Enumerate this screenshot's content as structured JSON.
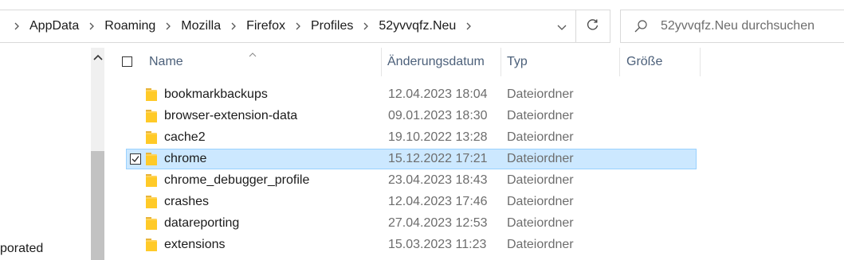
{
  "address_bar": {
    "breadcrumbs": [
      "AppData",
      "Roaming",
      "Mozilla",
      "Firefox",
      "Profiles",
      "52yvvqfz.Neu"
    ]
  },
  "search": {
    "placeholder": "52yvvqfz.Neu durchsuchen"
  },
  "nav_pane": {
    "partial_item": "porated"
  },
  "columns": {
    "name": "Name",
    "modified": "Änderungsdatum",
    "type": "Typ",
    "size": "Größe"
  },
  "files": [
    {
      "name": "bookmarkbackups",
      "modified": "12.04.2023 18:04",
      "type": "Dateiordner",
      "selected": false
    },
    {
      "name": "browser-extension-data",
      "modified": "09.01.2023 18:30",
      "type": "Dateiordner",
      "selected": false
    },
    {
      "name": "cache2",
      "modified": "19.10.2022 13:28",
      "type": "Dateiordner",
      "selected": false
    },
    {
      "name": "chrome",
      "modified": "15.12.2022 17:21",
      "type": "Dateiordner",
      "selected": true
    },
    {
      "name": "chrome_debugger_profile",
      "modified": "23.04.2023 18:43",
      "type": "Dateiordner",
      "selected": false
    },
    {
      "name": "crashes",
      "modified": "12.04.2023 17:46",
      "type": "Dateiordner",
      "selected": false
    },
    {
      "name": "datareporting",
      "modified": "27.04.2023 12:53",
      "type": "Dateiordner",
      "selected": false
    },
    {
      "name": "extensions",
      "modified": "15.03.2023 11:23",
      "type": "Dateiordner",
      "selected": false
    }
  ],
  "colors": {
    "selection_bg": "#cce8ff",
    "selection_border": "#99d1ff",
    "folder": "#ffd358",
    "header_text": "#4c607a"
  }
}
